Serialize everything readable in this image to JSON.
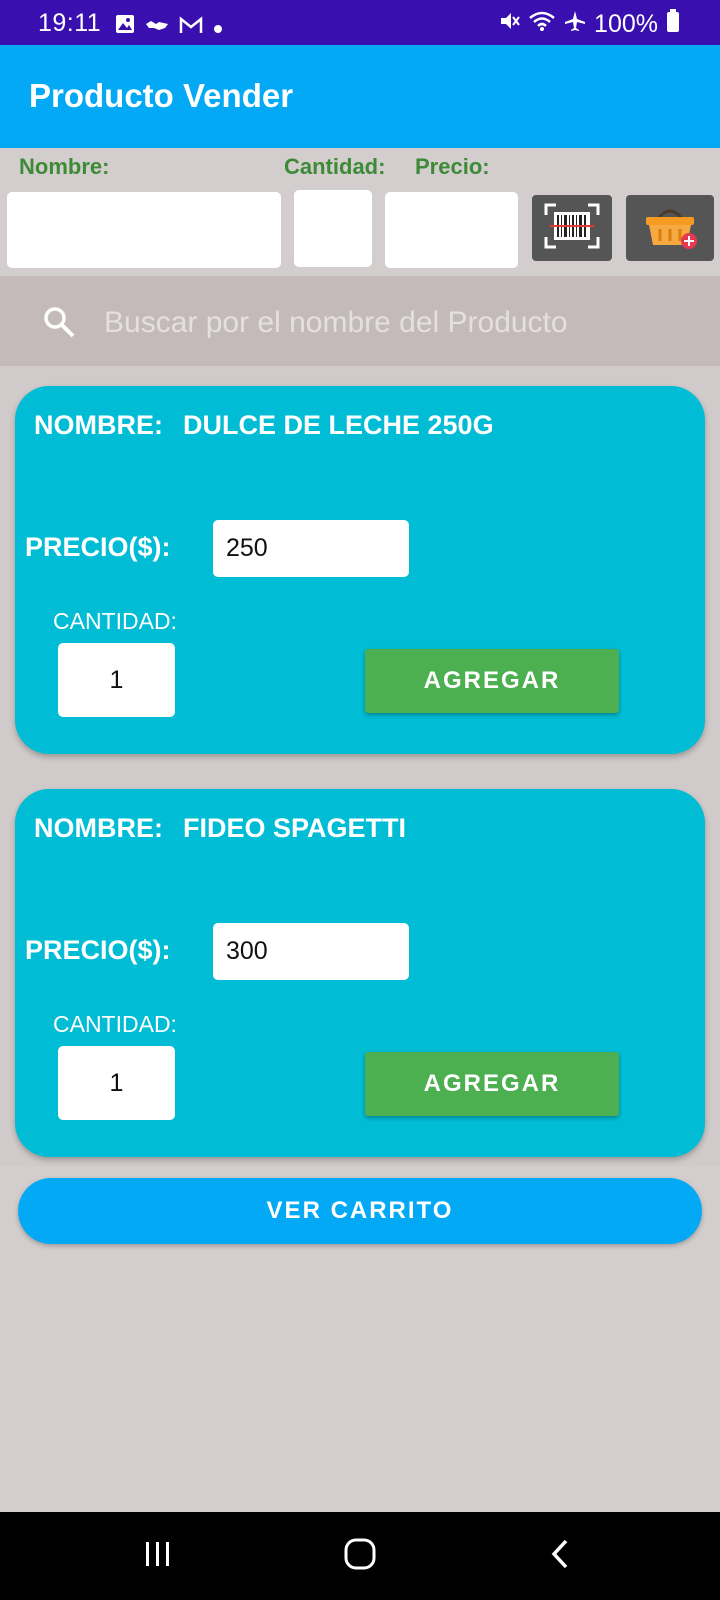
{
  "status_bar": {
    "time": "19:11",
    "battery": "100%"
  },
  "app_bar": {
    "title": "Producto Vender"
  },
  "form": {
    "nombre_label": "Nombre:",
    "cantidad_label": "Cantidad:",
    "precio_label": "Precio:",
    "nombre_value": "",
    "cantidad_value": "",
    "precio_value": ""
  },
  "search": {
    "placeholder": "Buscar por el nombre del Producto"
  },
  "products": [
    {
      "name_label": "NOMBRE:",
      "name": "DULCE DE LECHE 250G",
      "price_label": "PRECIO($):",
      "price": "250",
      "quantity_label": "CANTIDAD:",
      "quantity": "1",
      "add_label": "AGREGAR"
    },
    {
      "name_label": "NOMBRE:",
      "name": "FIDEO SPAGETTI",
      "price_label": "PRECIO($):",
      "price": "300",
      "quantity_label": "CANTIDAD:",
      "quantity": "1",
      "add_label": "AGREGAR"
    }
  ],
  "cart_button": {
    "label": "VER CARRITO"
  },
  "colors": {
    "status_bar": "#3a0fb0",
    "app_bar": "#03a9f4",
    "card": "#00bcd4",
    "add_button": "#4caf50",
    "label_green": "#3d8b37"
  },
  "icons": [
    "image-icon",
    "handshake-icon",
    "gmail-icon",
    "mute-icon",
    "wifi-icon",
    "airplane-icon",
    "battery-icon",
    "barcode-scanner-icon",
    "basket-add-icon",
    "search-icon",
    "recent-apps-icon",
    "home-icon",
    "back-icon"
  ]
}
